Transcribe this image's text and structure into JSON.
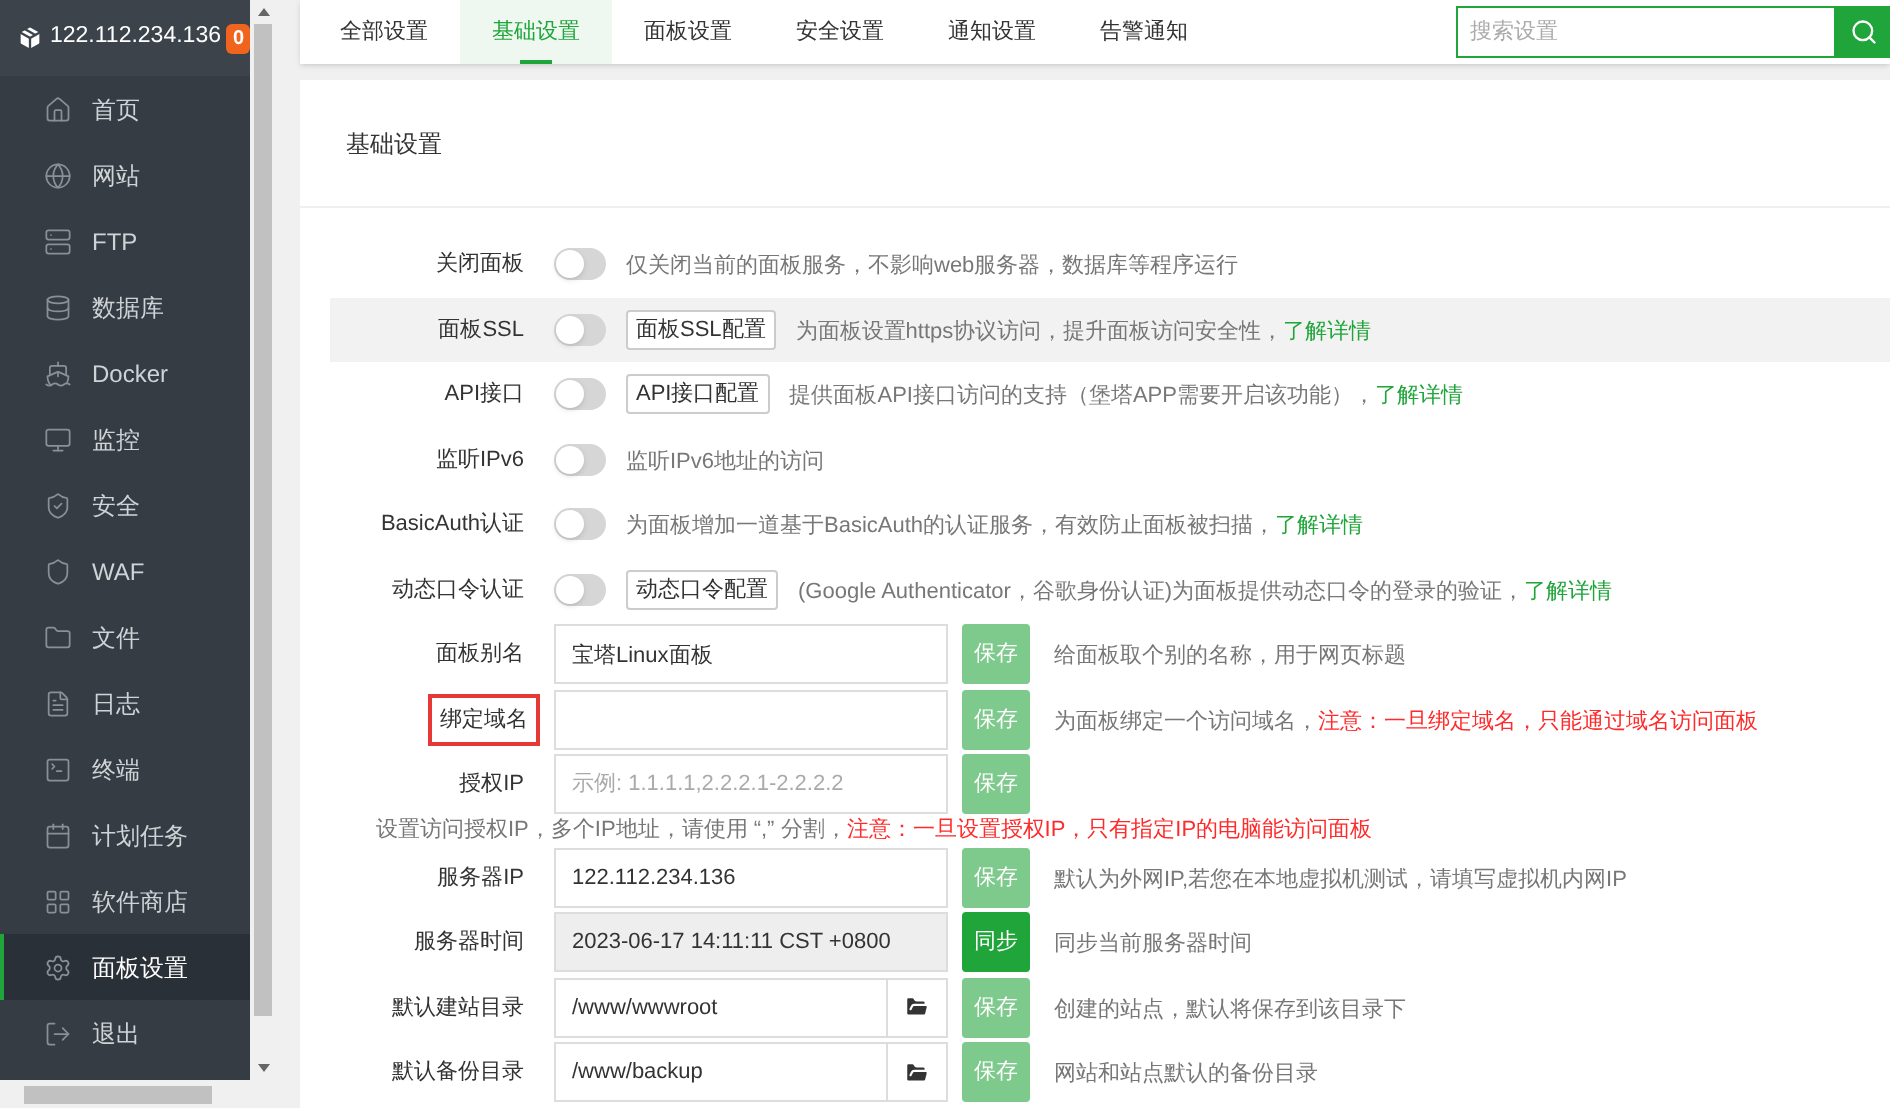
{
  "sidebar": {
    "host": "122.112.234.136",
    "badge": "0",
    "items": [
      {
        "label": "首页",
        "selected": false
      },
      {
        "label": "网站",
        "selected": false
      },
      {
        "label": "FTP",
        "selected": false
      },
      {
        "label": "数据库",
        "selected": false
      },
      {
        "label": "Docker",
        "selected": false
      },
      {
        "label": "监控",
        "selected": false
      },
      {
        "label": "安全",
        "selected": false
      },
      {
        "label": "WAF",
        "selected": false
      },
      {
        "label": "文件",
        "selected": false
      },
      {
        "label": "日志",
        "selected": false
      },
      {
        "label": "终端",
        "selected": false
      },
      {
        "label": "计划任务",
        "selected": false
      },
      {
        "label": "软件商店",
        "selected": false
      },
      {
        "label": "面板设置",
        "selected": true
      },
      {
        "label": "退出",
        "selected": false
      }
    ]
  },
  "tabs": [
    {
      "label": "全部设置",
      "selected": false
    },
    {
      "label": "基础设置",
      "selected": true
    },
    {
      "label": "面板设置",
      "selected": false
    },
    {
      "label": "安全设置",
      "selected": false
    },
    {
      "label": "通知设置",
      "selected": false
    },
    {
      "label": "告警通知",
      "selected": false
    }
  ],
  "search": {
    "placeholder": "搜索设置"
  },
  "section": {
    "title": "基础设置",
    "rows": [
      {
        "kind": "toggle",
        "label": "关闭面板",
        "on": false,
        "hovered": false,
        "desc": "仅关闭当前的面板服务，不影响web服务器，数据库等程序运行"
      },
      {
        "kind": "toggle",
        "label": "面板SSL",
        "on": false,
        "hovered": true,
        "config": "面板SSL配置",
        "desc": "为面板设置https协议访问，提升面板访问安全性，",
        "link": "了解详情"
      },
      {
        "kind": "toggle",
        "label": "API接口",
        "on": false,
        "hovered": false,
        "config": "API接口配置",
        "desc": "提供面板API接口访问的支持（堡塔APP需要开启该功能），",
        "link": "了解详情"
      },
      {
        "kind": "toggle",
        "label": "监听IPv6",
        "on": false,
        "hovered": false,
        "desc": "监听IPv6地址的访问"
      },
      {
        "kind": "toggle",
        "label": "BasicAuth认证",
        "on": false,
        "hovered": false,
        "desc": "为面板增加一道基于BasicAuth的认证服务，有效防止面板被扫描，",
        "link": "了解详情"
      },
      {
        "kind": "toggle",
        "label": "动态口令认证",
        "on": false,
        "hovered": false,
        "config": "动态口令配置",
        "desc": "(Google Authenticator，谷歌身份认证)为面板提供动态口令的登录的验证，",
        "link": "了解详情"
      },
      {
        "kind": "input",
        "label": "面板别名",
        "value": "宝塔Linux面板",
        "button": {
          "label": "保存",
          "kind": "save"
        },
        "desc": "给面板取个别的名称，用于网页标题"
      },
      {
        "kind": "input",
        "label": "绑定域名",
        "highlighted": true,
        "button": {
          "label": "保存",
          "kind": "save"
        },
        "desc": "为面板绑定一个访问域名，",
        "warning": "注意：一旦绑定域名，只能通过域名访问面板"
      },
      {
        "kind": "input",
        "label": "授权IP",
        "placeholder": "示例: 1.1.1.1,2.2.2.1-2.2.2.2",
        "button": {
          "label": "保存",
          "kind": "save"
        }
      },
      {
        "kind": "note",
        "desc": "设置访问授权IP，多个IP地址，请使用 “,” 分割，",
        "warning": "注意：一旦设置授权IP，只有指定IP的电脑能访问面板"
      },
      {
        "kind": "input",
        "label": "服务器IP",
        "value": "122.112.234.136",
        "button": {
          "label": "保存",
          "kind": "save"
        },
        "desc": "默认为外网IP,若您在本地虚拟机测试，请填写虚拟机内网IP"
      },
      {
        "kind": "input",
        "label": "服务器时间",
        "value": "2023-06-17 14:11:11 CST +0800",
        "readonly": true,
        "button": {
          "label": "同步",
          "kind": "sync"
        },
        "desc": "同步当前服务器时间"
      },
      {
        "kind": "input",
        "label": "默认建站目录",
        "value": "/www/wwwroot",
        "picker": true,
        "button": {
          "label": "保存",
          "kind": "save"
        },
        "desc": "创建的站点，默认将保存到该目录下"
      },
      {
        "kind": "input",
        "label": "默认备份目录",
        "value": "/www/backup",
        "picker": true,
        "button": {
          "label": "保存",
          "kind": "save"
        },
        "desc": "网站和站点默认的备份目录"
      }
    ]
  }
}
